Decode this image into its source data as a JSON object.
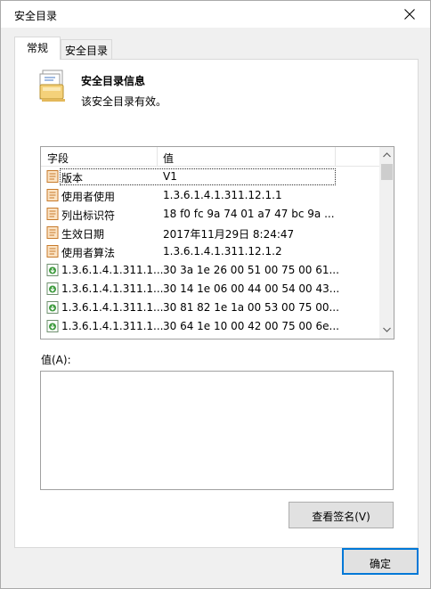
{
  "window": {
    "title": "安全目录"
  },
  "tabs": [
    {
      "label": "常规",
      "active": true
    },
    {
      "label": "安全目录",
      "active": false
    }
  ],
  "info": {
    "title": "安全目录信息",
    "subtitle": "该安全目录有效。"
  },
  "list": {
    "columns": [
      "字段",
      "值"
    ],
    "rows": [
      {
        "icon": "property-icon",
        "name": "版本",
        "value": "V1"
      },
      {
        "icon": "property-icon",
        "name": "使用者使用",
        "value": "1.3.6.1.4.1.311.12.1.1"
      },
      {
        "icon": "property-icon",
        "name": "列出标识符",
        "value": "18 f0 fc 9a 74 01 a7 47 bc 9a ..."
      },
      {
        "icon": "property-icon",
        "name": "生效日期",
        "value": "2017年11月29日 8:24:47"
      },
      {
        "icon": "property-icon",
        "name": "使用者算法",
        "value": "1.3.6.1.4.1.311.12.1.2"
      },
      {
        "icon": "extension-icon",
        "name": "1.3.6.1.4.1.311.1...",
        "value": "30 3a 1e 26 00 51 00 75 00 61..."
      },
      {
        "icon": "extension-icon",
        "name": "1.3.6.1.4.1.311.1...",
        "value": "30 14 1e 06 00 44 00 54 00 43..."
      },
      {
        "icon": "extension-icon",
        "name": "1.3.6.1.4.1.311.1...",
        "value": "30 81 82 1e 1a 00 53 00 75 00..."
      },
      {
        "icon": "extension-icon",
        "name": "1.3.6.1.4.1.311.1...",
        "value": "30 64 1e 10 00 42 00 75 00 6e..."
      }
    ]
  },
  "value_label": "值(A):",
  "buttons": {
    "view_signature": "查看签名(V)",
    "ok": "确定"
  }
}
